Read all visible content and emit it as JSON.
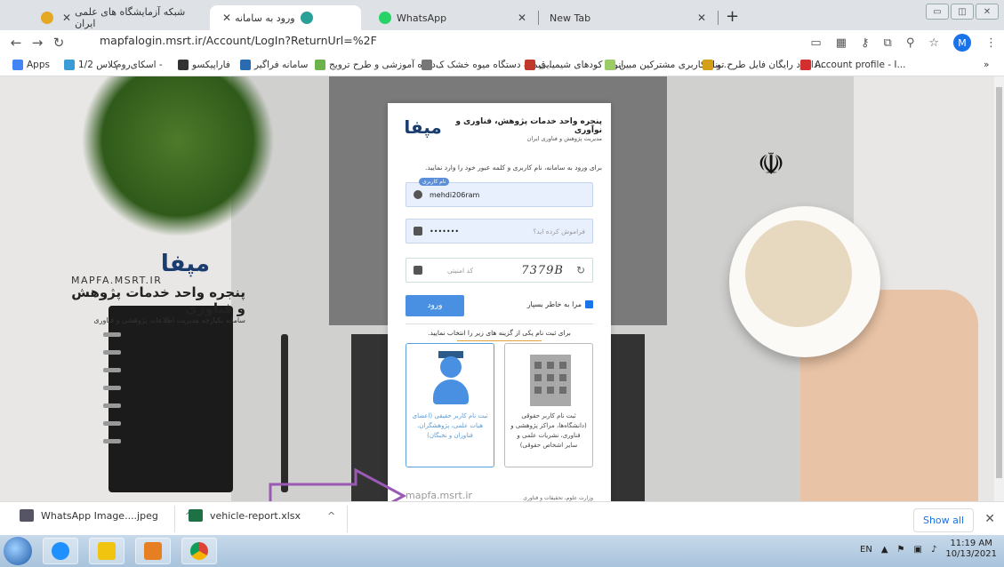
{
  "tabs": [
    {
      "label": "شبکه آزمایشگاه های علمی ایران",
      "active": false
    },
    {
      "label": "ورود به سامانه",
      "active": true
    },
    {
      "label": "WhatsApp",
      "active": false
    },
    {
      "label": "New Tab",
      "active": false
    }
  ],
  "toolbar": {
    "url": "mapfalogin.msrt.ir/Account/LogIn?ReturnUrl=%2F",
    "profile_initial": "M"
  },
  "bookmarks": {
    "apps": "Apps",
    "items": [
      "کلاس 1/2",
      "اسکای‌روم -",
      "فاراپیکسو",
      "سامانه فراگیر",
      "دوره آموزشی و طرح ترویج...",
      "قیمت دستگاه میوه خشک ک...",
      "انواع کودهای شیمیایی",
      "پنل کاربری مشترکین مبین...",
      "دانلود رایگان فایل طرح تو...",
      "Account profile - I..."
    ],
    "more": "»"
  },
  "brand": {
    "logo": "مپفا",
    "site": "MAPFA.MSRT.IR",
    "title": "پنجره واحد خدمات پژوهش و فناوری",
    "subtitle": "سامانه یکپارچه مدیریت اطلاعات پژوهشی و فناوری"
  },
  "emblem_text": "جمهوری اسلامی ایران وزارت علوم، تحقیقات و فناوری",
  "card": {
    "logo": "مپفا",
    "title": "پنجره واحد خدمات پژوهش، فناوری و نوآوری",
    "subtitle": "مدیریت پژوهش و فناوری ایران",
    "intro": "برای ورود به سامانه، نام کاربری و کلمه عبور خود را وارد نمایید.",
    "username_badge": "نام کاربری",
    "username_value": "mehdi206ram",
    "password_value": "•••••••",
    "forgot": "فراموش کرده اید؟",
    "captcha_placeholder": "کد امنیتی",
    "captcha_code": "7379B",
    "login_button": "ورود",
    "remember_me": "مرا به خاطر بسپار",
    "register_hint": "برای ثبت نام یکی از گزینه های زیر را انتخاب نمایید.",
    "option_researcher": "ثبت نام کاربر حقیقی (اعضای هیات علمی، پژوهشگران، فناوران و نخبگان)",
    "option_legal": "ثبت نام کاربر حقوقی (دانشگاه‌ها، مراکز پژوهشی و فناوری، نشریات علمی و سایر اشخاص حقوقی)",
    "footer_site": "mapfa.msrt.ir",
    "footer_ministry": "وزارت علوم، تحقیقات و فناوری"
  },
  "downloads": [
    {
      "name": "WhatsApp Image....jpeg"
    },
    {
      "name": "vehicle-report.xlsx"
    }
  ],
  "show_all": "Show all",
  "taskbar": {
    "lang": "EN",
    "time": "11:19 AM",
    "date": "10/13/2021"
  },
  "colors": {
    "accent": "#4a90e2",
    "arrow": "#9b59b6"
  }
}
